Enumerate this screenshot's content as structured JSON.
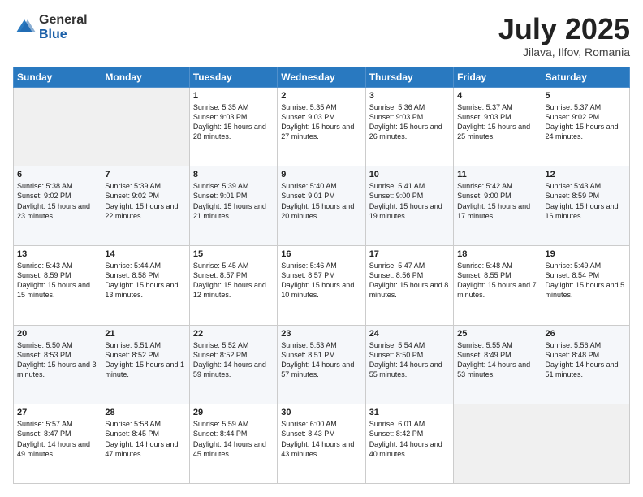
{
  "logo": {
    "general": "General",
    "blue": "Blue"
  },
  "header": {
    "month": "July 2025",
    "location": "Jilava, Ilfov, Romania"
  },
  "weekdays": [
    "Sunday",
    "Monday",
    "Tuesday",
    "Wednesday",
    "Thursday",
    "Friday",
    "Saturday"
  ],
  "weeks": [
    [
      {
        "day": "",
        "sunrise": "",
        "sunset": "",
        "daylight": ""
      },
      {
        "day": "",
        "sunrise": "",
        "sunset": "",
        "daylight": ""
      },
      {
        "day": "1",
        "sunrise": "Sunrise: 5:35 AM",
        "sunset": "Sunset: 9:03 PM",
        "daylight": "Daylight: 15 hours and 28 minutes."
      },
      {
        "day": "2",
        "sunrise": "Sunrise: 5:35 AM",
        "sunset": "Sunset: 9:03 PM",
        "daylight": "Daylight: 15 hours and 27 minutes."
      },
      {
        "day": "3",
        "sunrise": "Sunrise: 5:36 AM",
        "sunset": "Sunset: 9:03 PM",
        "daylight": "Daylight: 15 hours and 26 minutes."
      },
      {
        "day": "4",
        "sunrise": "Sunrise: 5:37 AM",
        "sunset": "Sunset: 9:03 PM",
        "daylight": "Daylight: 15 hours and 25 minutes."
      },
      {
        "day": "5",
        "sunrise": "Sunrise: 5:37 AM",
        "sunset": "Sunset: 9:02 PM",
        "daylight": "Daylight: 15 hours and 24 minutes."
      }
    ],
    [
      {
        "day": "6",
        "sunrise": "Sunrise: 5:38 AM",
        "sunset": "Sunset: 9:02 PM",
        "daylight": "Daylight: 15 hours and 23 minutes."
      },
      {
        "day": "7",
        "sunrise": "Sunrise: 5:39 AM",
        "sunset": "Sunset: 9:02 PM",
        "daylight": "Daylight: 15 hours and 22 minutes."
      },
      {
        "day": "8",
        "sunrise": "Sunrise: 5:39 AM",
        "sunset": "Sunset: 9:01 PM",
        "daylight": "Daylight: 15 hours and 21 minutes."
      },
      {
        "day": "9",
        "sunrise": "Sunrise: 5:40 AM",
        "sunset": "Sunset: 9:01 PM",
        "daylight": "Daylight: 15 hours and 20 minutes."
      },
      {
        "day": "10",
        "sunrise": "Sunrise: 5:41 AM",
        "sunset": "Sunset: 9:00 PM",
        "daylight": "Daylight: 15 hours and 19 minutes."
      },
      {
        "day": "11",
        "sunrise": "Sunrise: 5:42 AM",
        "sunset": "Sunset: 9:00 PM",
        "daylight": "Daylight: 15 hours and 17 minutes."
      },
      {
        "day": "12",
        "sunrise": "Sunrise: 5:43 AM",
        "sunset": "Sunset: 8:59 PM",
        "daylight": "Daylight: 15 hours and 16 minutes."
      }
    ],
    [
      {
        "day": "13",
        "sunrise": "Sunrise: 5:43 AM",
        "sunset": "Sunset: 8:59 PM",
        "daylight": "Daylight: 15 hours and 15 minutes."
      },
      {
        "day": "14",
        "sunrise": "Sunrise: 5:44 AM",
        "sunset": "Sunset: 8:58 PM",
        "daylight": "Daylight: 15 hours and 13 minutes."
      },
      {
        "day": "15",
        "sunrise": "Sunrise: 5:45 AM",
        "sunset": "Sunset: 8:57 PM",
        "daylight": "Daylight: 15 hours and 12 minutes."
      },
      {
        "day": "16",
        "sunrise": "Sunrise: 5:46 AM",
        "sunset": "Sunset: 8:57 PM",
        "daylight": "Daylight: 15 hours and 10 minutes."
      },
      {
        "day": "17",
        "sunrise": "Sunrise: 5:47 AM",
        "sunset": "Sunset: 8:56 PM",
        "daylight": "Daylight: 15 hours and 8 minutes."
      },
      {
        "day": "18",
        "sunrise": "Sunrise: 5:48 AM",
        "sunset": "Sunset: 8:55 PM",
        "daylight": "Daylight: 15 hours and 7 minutes."
      },
      {
        "day": "19",
        "sunrise": "Sunrise: 5:49 AM",
        "sunset": "Sunset: 8:54 PM",
        "daylight": "Daylight: 15 hours and 5 minutes."
      }
    ],
    [
      {
        "day": "20",
        "sunrise": "Sunrise: 5:50 AM",
        "sunset": "Sunset: 8:53 PM",
        "daylight": "Daylight: 15 hours and 3 minutes."
      },
      {
        "day": "21",
        "sunrise": "Sunrise: 5:51 AM",
        "sunset": "Sunset: 8:52 PM",
        "daylight": "Daylight: 15 hours and 1 minute."
      },
      {
        "day": "22",
        "sunrise": "Sunrise: 5:52 AM",
        "sunset": "Sunset: 8:52 PM",
        "daylight": "Daylight: 14 hours and 59 minutes."
      },
      {
        "day": "23",
        "sunrise": "Sunrise: 5:53 AM",
        "sunset": "Sunset: 8:51 PM",
        "daylight": "Daylight: 14 hours and 57 minutes."
      },
      {
        "day": "24",
        "sunrise": "Sunrise: 5:54 AM",
        "sunset": "Sunset: 8:50 PM",
        "daylight": "Daylight: 14 hours and 55 minutes."
      },
      {
        "day": "25",
        "sunrise": "Sunrise: 5:55 AM",
        "sunset": "Sunset: 8:49 PM",
        "daylight": "Daylight: 14 hours and 53 minutes."
      },
      {
        "day": "26",
        "sunrise": "Sunrise: 5:56 AM",
        "sunset": "Sunset: 8:48 PM",
        "daylight": "Daylight: 14 hours and 51 minutes."
      }
    ],
    [
      {
        "day": "27",
        "sunrise": "Sunrise: 5:57 AM",
        "sunset": "Sunset: 8:47 PM",
        "daylight": "Daylight: 14 hours and 49 minutes."
      },
      {
        "day": "28",
        "sunrise": "Sunrise: 5:58 AM",
        "sunset": "Sunset: 8:45 PM",
        "daylight": "Daylight: 14 hours and 47 minutes."
      },
      {
        "day": "29",
        "sunrise": "Sunrise: 5:59 AM",
        "sunset": "Sunset: 8:44 PM",
        "daylight": "Daylight: 14 hours and 45 minutes."
      },
      {
        "day": "30",
        "sunrise": "Sunrise: 6:00 AM",
        "sunset": "Sunset: 8:43 PM",
        "daylight": "Daylight: 14 hours and 43 minutes."
      },
      {
        "day": "31",
        "sunrise": "Sunrise: 6:01 AM",
        "sunset": "Sunset: 8:42 PM",
        "daylight": "Daylight: 14 hours and 40 minutes."
      },
      {
        "day": "",
        "sunrise": "",
        "sunset": "",
        "daylight": ""
      },
      {
        "day": "",
        "sunrise": "",
        "sunset": "",
        "daylight": ""
      }
    ]
  ]
}
